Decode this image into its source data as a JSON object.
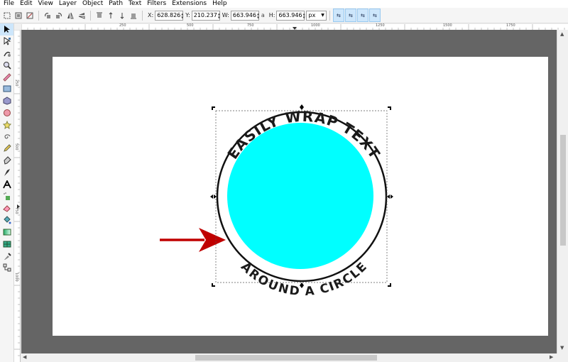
{
  "menu": [
    "File",
    "Edit",
    "View",
    "Layer",
    "Object",
    "Path",
    "Text",
    "Filters",
    "Extensions",
    "Help"
  ],
  "toolbar": {
    "x_label": "X:",
    "x_value": "628.826",
    "y_label": "Y:",
    "y_value": "210.237",
    "w_label": "W:",
    "w_value": "663.946",
    "h_label": "H:",
    "h_value": "663.946",
    "unit": "px",
    "lock_glyph": "a"
  },
  "ruler": {
    "h_ticks": [
      "250",
      "500",
      "750",
      "1000",
      "1250",
      "1500",
      "1750"
    ],
    "v_ticks": [
      "250",
      "500",
      "750",
      "1000"
    ]
  },
  "artwork": {
    "top_text": "EASILY WRAP TEXT",
    "bottom_text": "AROUND A CIRCLE",
    "circle_color": "#00ffff",
    "arrow_color": "#c00000"
  }
}
